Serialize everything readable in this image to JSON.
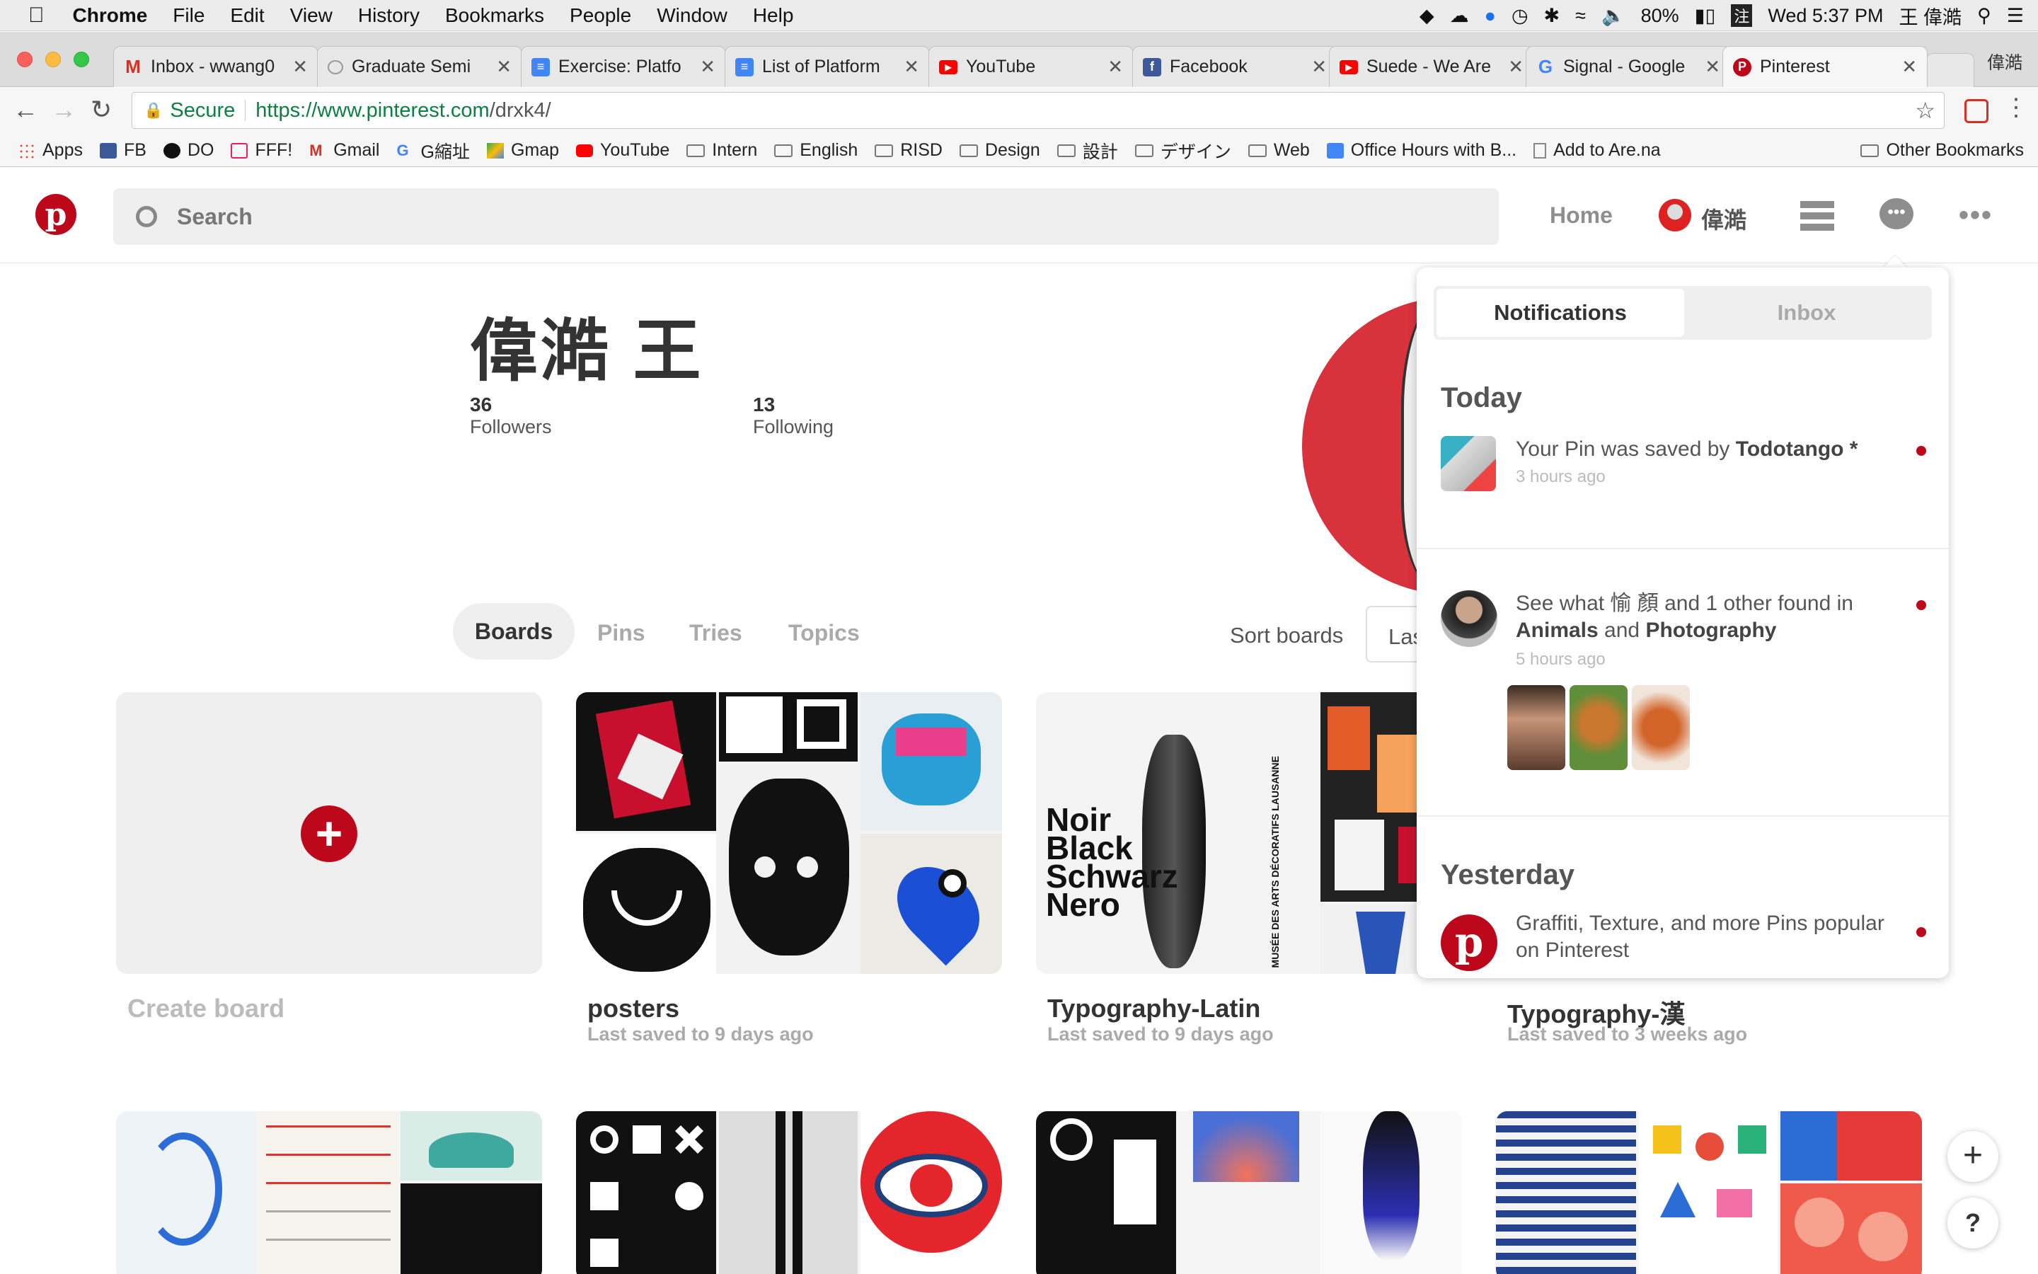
{
  "menubar": {
    "app": "Chrome",
    "items": [
      "File",
      "Edit",
      "View",
      "History",
      "Bookmarks",
      "People",
      "Window",
      "Help"
    ],
    "battery": "80%",
    "clock": "Wed 5:37 PM",
    "user": "王 偉澔"
  },
  "tabs": [
    {
      "title": "Inbox - wwang0",
      "color": "#d93025",
      "icon": "gmail-icon"
    },
    {
      "title": "Graduate Semi",
      "color": "#9e9e9e",
      "icon": "chat-icon"
    },
    {
      "title": "Exercise: Platfo",
      "color": "#4285f4",
      "icon": "docs-icon"
    },
    {
      "title": "List of Platform",
      "color": "#4285f4",
      "icon": "docs-icon"
    },
    {
      "title": "YouTube",
      "color": "#ff0000",
      "icon": "youtube-icon"
    },
    {
      "title": "Facebook",
      "color": "#3b5998",
      "icon": "facebook-icon"
    },
    {
      "title": "Suede - We Are",
      "color": "#ff0000",
      "icon": "youtube-icon"
    },
    {
      "title": "Signal - Google",
      "color": "#4285f4",
      "icon": "google-icon"
    },
    {
      "title": "Pinterest",
      "color": "#bd081c",
      "icon": "pinterest-icon"
    }
  ],
  "window_user": "偉澔",
  "address": {
    "secure_label": "Secure",
    "url_host": "https://www.pinterest.com",
    "url_path": "/drxk4/"
  },
  "bookmarks": [
    {
      "label": "Apps",
      "icon": "apps-icon"
    },
    {
      "label": "FB",
      "icon": "facebook-icon"
    },
    {
      "label": "DO",
      "icon": "do-icon"
    },
    {
      "label": "FFF!",
      "icon": "heart-icon"
    },
    {
      "label": "Gmail",
      "icon": "gmail-icon"
    },
    {
      "label": "G縮址",
      "icon": "google-icon"
    },
    {
      "label": "Gmap",
      "icon": "maps-icon"
    },
    {
      "label": "YouTube",
      "icon": "youtube-icon"
    },
    {
      "label": "Intern",
      "icon": "folder-icon"
    },
    {
      "label": "English",
      "icon": "folder-icon"
    },
    {
      "label": "RISD",
      "icon": "folder-icon"
    },
    {
      "label": "Design",
      "icon": "folder-icon"
    },
    {
      "label": "設計",
      "icon": "folder-icon"
    },
    {
      "label": "デザイン",
      "icon": "folder-icon"
    },
    {
      "label": "Web",
      "icon": "folder-icon"
    },
    {
      "label": "Office Hours with B...",
      "icon": "docs-icon"
    },
    {
      "label": "Add to Are.na",
      "icon": "page-icon"
    }
  ],
  "other_bookmarks": "Other Bookmarks",
  "header": {
    "search_placeholder": "Search",
    "home": "Home",
    "user": "偉澔"
  },
  "profile": {
    "name": "偉澔 王",
    "followers_count": "36",
    "followers_label": "Followers",
    "following_count": "13",
    "following_label": "Following"
  },
  "profile_tabs": [
    "Boards",
    "Pins",
    "Tries",
    "Topics"
  ],
  "sort": {
    "label": "Sort boards",
    "value": "Las"
  },
  "create_board": "Create board",
  "boards": [
    {
      "title": "posters",
      "subtitle": "Last saved to 9 days ago"
    },
    {
      "title": "Typography-Latin",
      "subtitle": "Last saved to 9 days ago"
    },
    {
      "title": "Typography-漢",
      "subtitle": "Last saved to 3 weeks ago"
    }
  ],
  "board_image_text": {
    "noir": [
      "Noir",
      "Black",
      "Schwarz",
      "Nero"
    ],
    "musee": "MUSÉE DES ARTS DÉCORATIFS LAUSANNE"
  },
  "notifications": {
    "tabs": [
      "Notifications",
      "Inbox"
    ],
    "today": "Today",
    "yesterday": "Yesterday",
    "items": [
      {
        "pre": "Your Pin was saved by ",
        "bold": "Todotango *",
        "post": "",
        "time": "3 hours ago"
      },
      {
        "pre": "See what 愉 顏 and 1 other found in ",
        "bold": "Animals",
        "mid": " and ",
        "bold2": "Photography",
        "time": "5 hours ago"
      },
      {
        "text": "Graffiti, Texture, and more Pins popular on Pinterest"
      }
    ]
  },
  "colors": {
    "pinterest_red": "#bd081c",
    "unread_dot": "#bd081c"
  }
}
